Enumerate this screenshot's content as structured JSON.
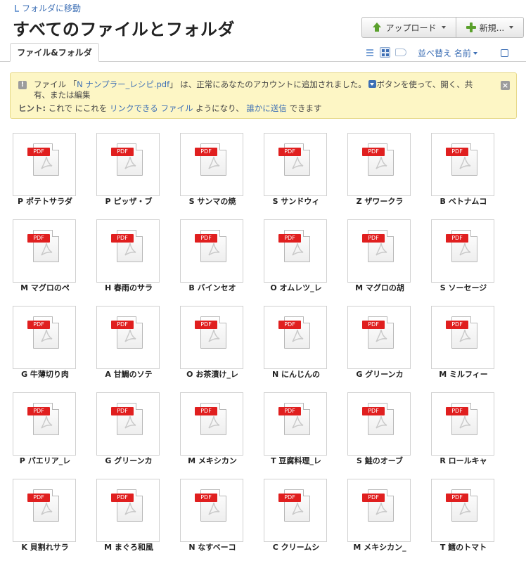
{
  "breadcrumb": {
    "label": "フォルダに移動"
  },
  "page": {
    "title": "すべてのファイルとフォルダ"
  },
  "toolbar": {
    "upload_label": "アップロード",
    "new_label": "新規..."
  },
  "tabs": [
    {
      "label": "ファイル&フォルダ"
    }
  ],
  "view": {
    "sort_label": "並べ替え 名前"
  },
  "notice": {
    "text_before": "ファイル 「",
    "file_name": "N ナンプラー_レシピ.pdf",
    "text_after": "」 は、正常にあなたのアカウントに追加されました。",
    "text_after2": "ボタンを使って、開く、共有、または編集",
    "hint_label": "ヒント:",
    "hint_text1": " これで にこれを ",
    "hint_link1": "リンクできる ファイル",
    "hint_text2": " ようになり、 ",
    "hint_link2": "誰かに送信",
    "hint_text3": " できます"
  },
  "file_badge": "PDF",
  "files": [
    "P ポテトサラダ",
    "P ピッザ・ブ",
    "S サンマの焼",
    "S サンドウィ",
    "Z ザワークラ",
    "B ベトナムコ",
    "M マグロのペ",
    "H 春雨のサラ",
    "B バインセオ",
    "O オムレツ_レ",
    "M マグロの胡",
    "S ソーセージ",
    "G 牛薄切り肉",
    "A 甘鯛のソテ",
    "O お茶漬け_レ",
    "N にんじんの",
    "G グリーンカ",
    "M ミルフィー",
    "P パエリア_レ",
    "G グリーンカ",
    "M メキシカン",
    "T 豆腐料理_レ",
    "S 鮭のオーブ",
    "R ロールキャ",
    "K 貝割れサラ",
    "M まぐろ和風",
    "N なすベーコ",
    "C クリームシ",
    "M メキシカン_",
    "T 鱈のトマト"
  ]
}
